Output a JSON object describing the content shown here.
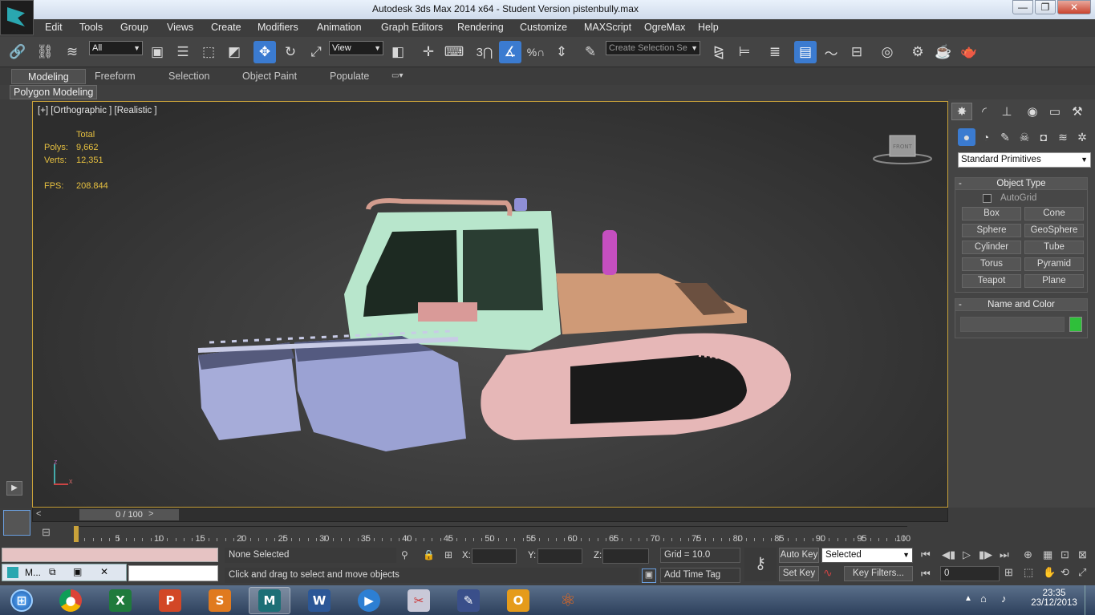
{
  "window": {
    "title": "Autodesk 3ds Max  2014 x64   - Student Version    pistenbully.max",
    "controls": {
      "minimize": "—",
      "restore": "❐",
      "close": "✕"
    }
  },
  "menu": [
    "Edit",
    "Tools",
    "Group",
    "Views",
    "Create",
    "Modifiers",
    "Animation",
    "Graph Editors",
    "Rendering",
    "Customize",
    "MAXScript",
    "OgreMax",
    "Help"
  ],
  "toolbar": {
    "filter_value": "All",
    "refcoord_value": "View",
    "selection_set_placeholder": "Create Selection Se",
    "snap_label": "3"
  },
  "ribbon": {
    "tabs": [
      "Modeling",
      "Freeform",
      "Selection",
      "Object Paint",
      "Populate"
    ],
    "active_tab": "Modeling",
    "panel_label": "Polygon Modeling"
  },
  "viewport": {
    "label": "[+] [Orthographic ] [Realistic ]",
    "stats": {
      "total_label": "Total",
      "polys_label": "Polys:",
      "polys_value": "9,662",
      "verts_label": "Verts:",
      "verts_value": "12,351",
      "fps_label": "FPS:",
      "fps_value": "208.844"
    },
    "viewcube_label": "FRONT",
    "axis_labels": {
      "z": "z",
      "x": "x"
    }
  },
  "command_panel": {
    "tab_icons": [
      "create-icon",
      "modify-icon",
      "hierarchy-icon",
      "motion-icon",
      "display-icon",
      "utilities-icon"
    ],
    "category": "Standard Primitives",
    "object_type_title": "Object Type",
    "autogrid_label": "AutoGrid",
    "primitives": [
      "Box",
      "Cone",
      "Sphere",
      "GeoSphere",
      "Cylinder",
      "Tube",
      "Torus",
      "Pyramid",
      "Teapot",
      "Plane"
    ],
    "name_color_title": "Name and Color",
    "name_value": "",
    "object_color": "#2fbf3a"
  },
  "timeline": {
    "time_slider": "0 / 100",
    "prev": "<",
    "next": ">",
    "ticks": [
      "0",
      "5",
      "10",
      "15",
      "20",
      "25",
      "30",
      "35",
      "40",
      "45",
      "50",
      "55",
      "60",
      "65",
      "70",
      "75",
      "80",
      "85",
      "90",
      "95",
      "100"
    ]
  },
  "status": {
    "selection": "None Selected",
    "prompt": "Click and drag to select and move objects",
    "x_label": "X:",
    "y_label": "Y:",
    "z_label": "Z:",
    "grid": "Grid = 10.0",
    "add_time_tag": "Add Time Tag",
    "auto_key": "Auto Key",
    "set_key": "Set Key",
    "key_mode": "Selected",
    "key_filters": "Key Filters...",
    "frame_value": "0"
  },
  "minimized_window": {
    "label": "M..."
  },
  "taskbar": {
    "apps": [
      "Internet Explorer",
      "Chrome",
      "Excel",
      "PowerPoint",
      "Slides",
      "3ds Max",
      "Word",
      "Media Player",
      "Paint",
      "Writer",
      "Outlook",
      "Other"
    ],
    "time": "23:35",
    "date": "23/12/2013"
  }
}
